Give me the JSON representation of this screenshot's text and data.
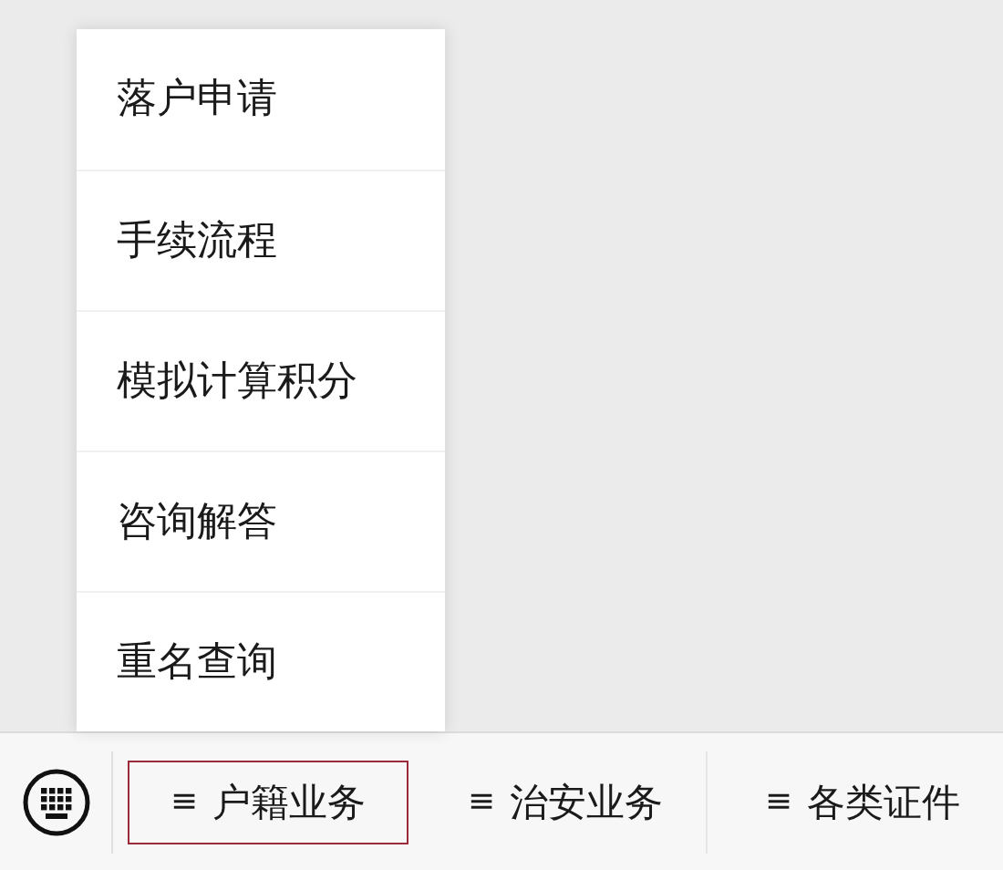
{
  "submenu": {
    "items": [
      {
        "label": "落户申请"
      },
      {
        "label": "手续流程"
      },
      {
        "label": "模拟计算积分"
      },
      {
        "label": "咨询解答"
      },
      {
        "label": "重名查询"
      }
    ]
  },
  "menu_bar": {
    "tabs": [
      {
        "icon": "≡",
        "label": "户籍业务",
        "selected": true
      },
      {
        "icon": "≡",
        "label": "治安业务",
        "selected": false
      },
      {
        "icon": "≡",
        "label": "各类证件",
        "selected": false
      }
    ]
  }
}
